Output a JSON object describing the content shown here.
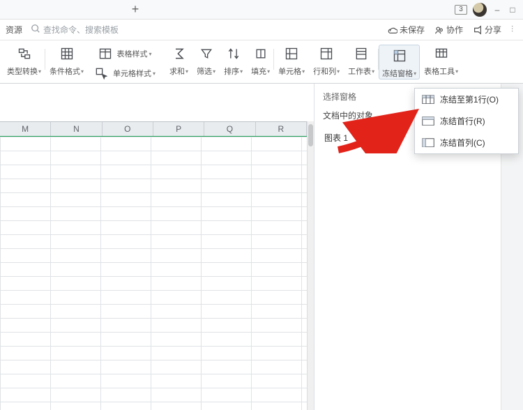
{
  "titlebar": {
    "badge": "3"
  },
  "menubar": {
    "resources": "资源",
    "search_placeholder": "查找命令、搜索模板",
    "unsaved": "未保存",
    "collab": "协作",
    "share": "分享"
  },
  "ribbon": {
    "type_convert": "类型转换",
    "cond_fmt": "条件格式",
    "table_style": "表格样式",
    "cell_style": "单元格样式",
    "sum": "求和",
    "filter": "筛选",
    "sort": "排序",
    "fill": "填充",
    "cells": "单元格",
    "rowcol": "行和列",
    "worksheet": "工作表",
    "freeze": "冻结窗格",
    "table_tools": "表格工具"
  },
  "columns": [
    "M",
    "N",
    "O",
    "P",
    "Q",
    "R"
  ],
  "panel": {
    "select_pane": "选择窗格",
    "objects": "文档中的对象",
    "chart1": "图表 1"
  },
  "dropdown": {
    "row1": "冻结至第1行(O)",
    "firstrow": "冻结首行(R)",
    "firstcol": "冻结首列(C)"
  }
}
